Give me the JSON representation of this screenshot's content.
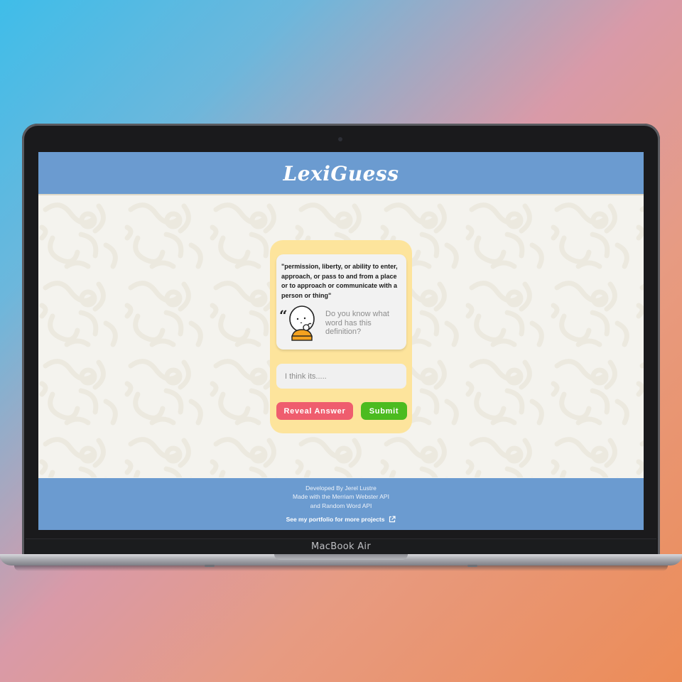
{
  "app": {
    "title": "LexiGuess",
    "definition": "\"permission, liberty, or ability to enter, approach, or pass to and from a place or to approach or communicate with a person or thing\"",
    "quote_glyph": "“",
    "prompt": "Do you know what word has this definition?",
    "guess_input": {
      "placeholder": "I think its.....",
      "value": ""
    },
    "buttons": {
      "reveal": "Reveal Answer",
      "submit": "Submit"
    },
    "colors": {
      "header": "#6b9bd0",
      "card": "#fde49c",
      "reveal": "#ef5d6e",
      "submit": "#4bbb20"
    }
  },
  "footer": {
    "lines": [
      "Developed By Jerel Lustre",
      "Made with the Merriam Webster API",
      "and Random Word API"
    ],
    "portfolio_link": "See my portfolio for more projects",
    "link_icon": "external-link-icon"
  },
  "device": {
    "label": "MacBook Air"
  }
}
